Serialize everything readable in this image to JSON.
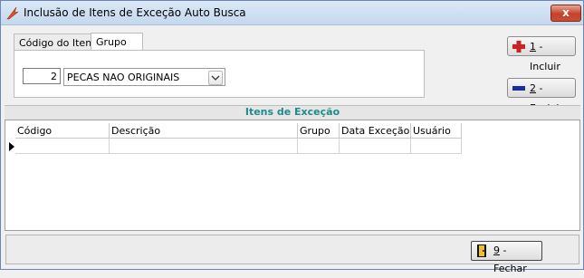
{
  "window": {
    "title": "Inclusão de Itens de Exceção Auto Busca",
    "close_label": "x"
  },
  "tabs": [
    {
      "label": "Código do Item",
      "active": false
    },
    {
      "label": "Grupo",
      "active": true
    }
  ],
  "group_filter": {
    "code_value": "2",
    "group_selected": "PECAS NAO ORIGINAIS"
  },
  "actions": {
    "incluir_hotkey": "1",
    "incluir_label": " - Incluir",
    "excluir_hotkey": "2",
    "excluir_label": " - Excluir",
    "fechar_hotkey": "9",
    "fechar_label": " - Fechar"
  },
  "section": {
    "title": "Itens de Exceção"
  },
  "grid": {
    "columns": [
      "Código",
      "Descrição",
      "Grupo",
      "Data Exceção",
      "Usuário"
    ],
    "rows": []
  },
  "colors": {
    "section_title": "#1c8c8c",
    "add_icon": "#cc2222",
    "remove_icon": "#1a2f9c",
    "titlebar": "#c5d8ee",
    "close_button": "#c4412b"
  },
  "icons": {
    "app": "lightning-app-icon",
    "incluir": "plus-icon",
    "excluir": "minus-icon",
    "fechar": "exit-door-icon"
  }
}
